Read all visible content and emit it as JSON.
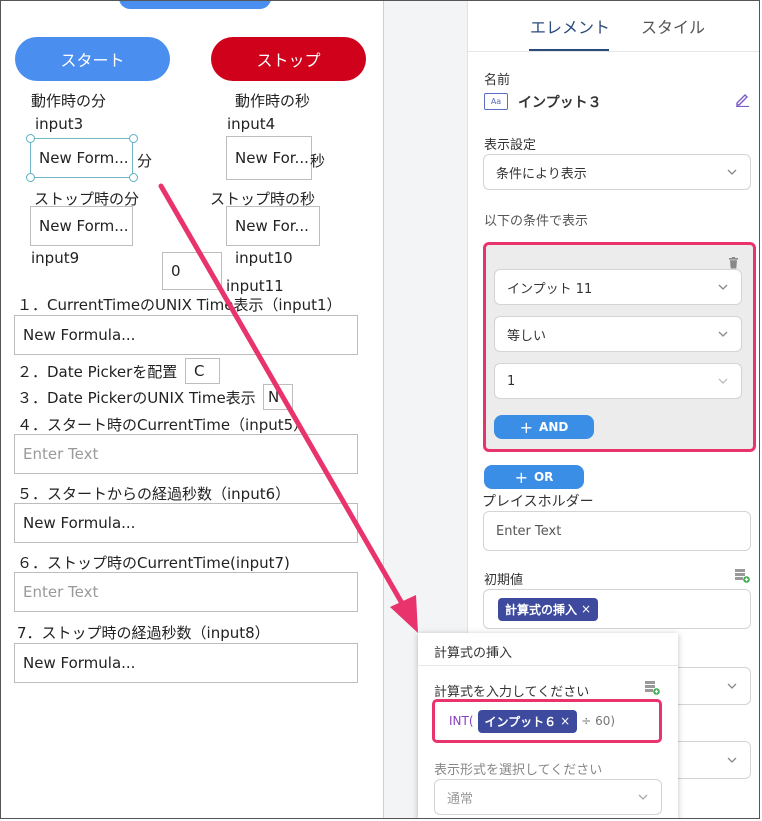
{
  "canvas": {
    "start_button": "スタート",
    "stop_button": "ストップ",
    "label_action_min": "動作時の分",
    "label_action_sec": "動作時の秒",
    "label_input3": "input3",
    "label_input4": "input4",
    "field_input3": "New Form...",
    "field_input4": "New For...",
    "unit_min": "分",
    "unit_sec": "秒",
    "label_stop_min": "ストップ時の分",
    "label_stop_sec": "ストップ時の秒",
    "field_stop_min": "New Form...",
    "field_stop_sec": "New For...",
    "label_input9": "input9",
    "field_zero": "0",
    "label_input10": "input10",
    "label_input11": "input11",
    "item1": "１．CurrentTimeのUNIX Time表示（input1）",
    "field_item1": "New Formula...",
    "item2": "２．Date Pickerを配置",
    "field_item2": "C",
    "item3": "３．Date PickerのUNIX Time表示",
    "field_item3": "N",
    "item4": "４．スタート時のCurrentTime（input5）",
    "field_item4_placeholder": "Enter Text",
    "item5": "５．スタートからの経過秒数（input6）",
    "field_item5": "New Formula...",
    "item6": "６．ストップ時のCurrentTime(input7)",
    "field_item6_placeholder": "Enter Text",
    "item7": "7．ストップ時の経過秒数（input8）",
    "field_item7": "New Formula..."
  },
  "panel": {
    "tab_element": "エレメント",
    "tab_style": "スタイル",
    "name_label": "名前",
    "name_value": "インプット３",
    "display_label": "表示設定",
    "display_value": "条件により表示",
    "condition_label": "以下の条件で表示",
    "cond_field": "インプット 11",
    "cond_operator": "等しい",
    "cond_value": "1",
    "and_button": "AND",
    "or_button": "OR",
    "placeholder_label": "プレイスホルダー",
    "placeholder_value": "Enter Text",
    "initial_label": "初期値",
    "initial_tag": "計算式の挿入"
  },
  "popup": {
    "title": "計算式の挿入",
    "formula_label": "計算式を入力してください",
    "formula_prefix": "INT(",
    "formula_tag": "インプット６",
    "formula_suffix": "÷ 60)",
    "format_label": "表示形式を選択してください",
    "format_value": "通常"
  },
  "colors": {
    "start": "#4a8ef0",
    "stop": "#d0021b",
    "highlight": "#e8336d",
    "action_blue": "#3a8ee6",
    "tag": "#3d4a9e",
    "tab_active": "#2a4b7c"
  }
}
